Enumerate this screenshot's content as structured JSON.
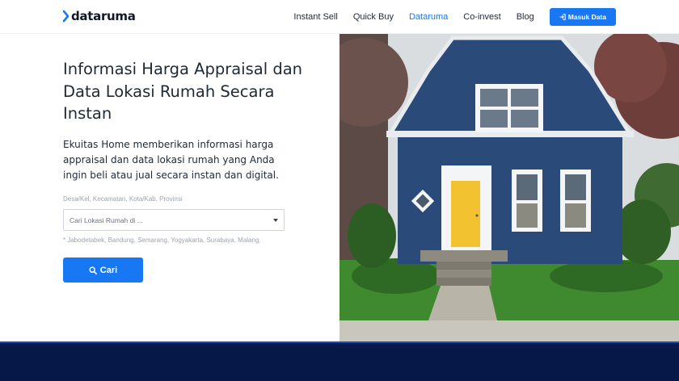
{
  "brand": {
    "name": "dataruma",
    "accent_color": "#1877f2",
    "dark_color": "#061848"
  },
  "nav": {
    "items": [
      {
        "label": "Instant Sell",
        "active": false
      },
      {
        "label": "Quick Buy",
        "active": false
      },
      {
        "label": "Dataruma",
        "active": true
      },
      {
        "label": "Co-invest",
        "active": false
      },
      {
        "label": "Blog",
        "active": false
      }
    ],
    "login_button": {
      "label": "Masuk Data",
      "icon": "sign-in-icon"
    }
  },
  "hero": {
    "title": "Informasi Harga Appraisal dan Data Lokasi Rumah Secara Instan",
    "description": "Ekuitas Home memberikan informasi harga appraisal dan data lokasi rumah yang Anda ingin beli atau jual secara instan dan digital.",
    "search": {
      "label": "Desa/Kel, Kecamatan, Kota/Kab, Provinsi",
      "placeholder": "Cari Lokasi Rumah di ...",
      "note": "* Jabodetabek, Bandung, Semarang, Yogyakarta, Surabaya, Malang.",
      "button_label": "Cari",
      "button_icon": "search-icon"
    },
    "image": {
      "subject": "house-photo"
    }
  }
}
